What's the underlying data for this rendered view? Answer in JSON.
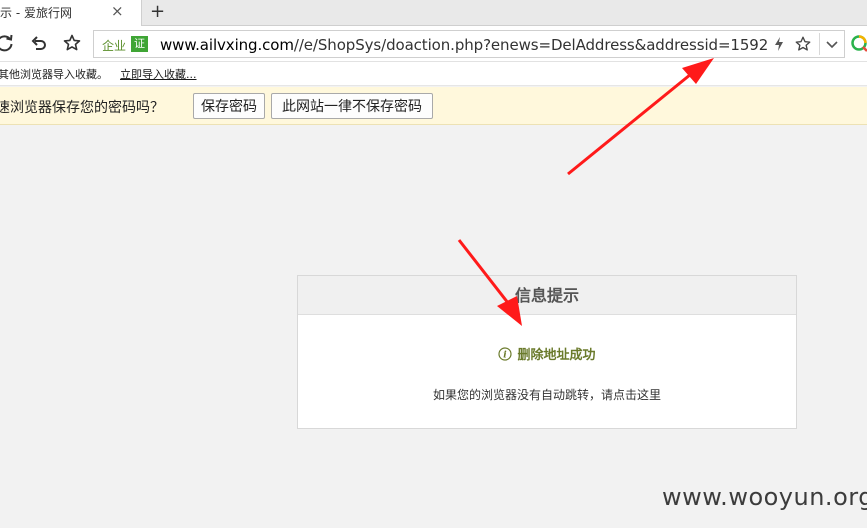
{
  "browser": {
    "tab": {
      "title": "示 - 爱旅行网",
      "close": "×",
      "new_tab": "+"
    },
    "address": {
      "enterprise_label": "企业",
      "cert_badge": "证",
      "url_host": "www.ailvxing.com",
      "url_path": "//e/ShopSys/doaction.php?enews=DelAddress&addressid=1592"
    },
    "bookmarks": {
      "import_text": "其他浏览器导入收藏。",
      "import_link": "立即导入收藏..."
    },
    "password_bar": {
      "question": "速浏览器保存您的密码吗？",
      "save_button": "保存密码",
      "never_button": "此网站一律不保存密码"
    }
  },
  "message": {
    "title": "信息提示",
    "text": "删除地址成功",
    "redirect_note": "如果您的浏览器没有自动跳转，请点击这里"
  },
  "colors": {
    "arrow": "#ff1a1a",
    "success_text": "#6a7a2b",
    "password_bar_bg": "#fff8dc"
  },
  "watermark": "www.wooyun.org"
}
